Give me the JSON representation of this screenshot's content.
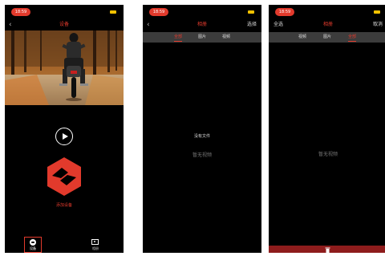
{
  "screen1": {
    "status": {
      "time": "18:59"
    },
    "title": "设备",
    "add_device": "添加设备",
    "tabs": [
      {
        "label": "设备",
        "icon": "device-icon",
        "active": true
      },
      {
        "label": "相册",
        "icon": "album-icon",
        "active": false
      }
    ]
  },
  "screen2": {
    "status": {
      "time": "18:59"
    },
    "title": "相册",
    "right_action": "选择",
    "filters": [
      "全部",
      "图片",
      "视频"
    ],
    "active_filter": "全部",
    "no_file": "没有文件",
    "empty_label": "暂无视频"
  },
  "screen3": {
    "status": {
      "time": "18:59"
    },
    "title": "相册",
    "left_action": "全选",
    "right_action": "取消",
    "filters": [
      "视频",
      "图片",
      "全部"
    ],
    "active_filter": "全部",
    "empty_label": "暂无视频"
  },
  "colors": {
    "accent": "#e23a2c",
    "background": "#000000",
    "filterbar": "#3c3c3c",
    "deletebar": "#8e1c1c"
  },
  "icons": [
    "back-icon",
    "play-icon",
    "logo-icon",
    "device-icon",
    "album-icon",
    "trash-icon",
    "battery-icon"
  ]
}
